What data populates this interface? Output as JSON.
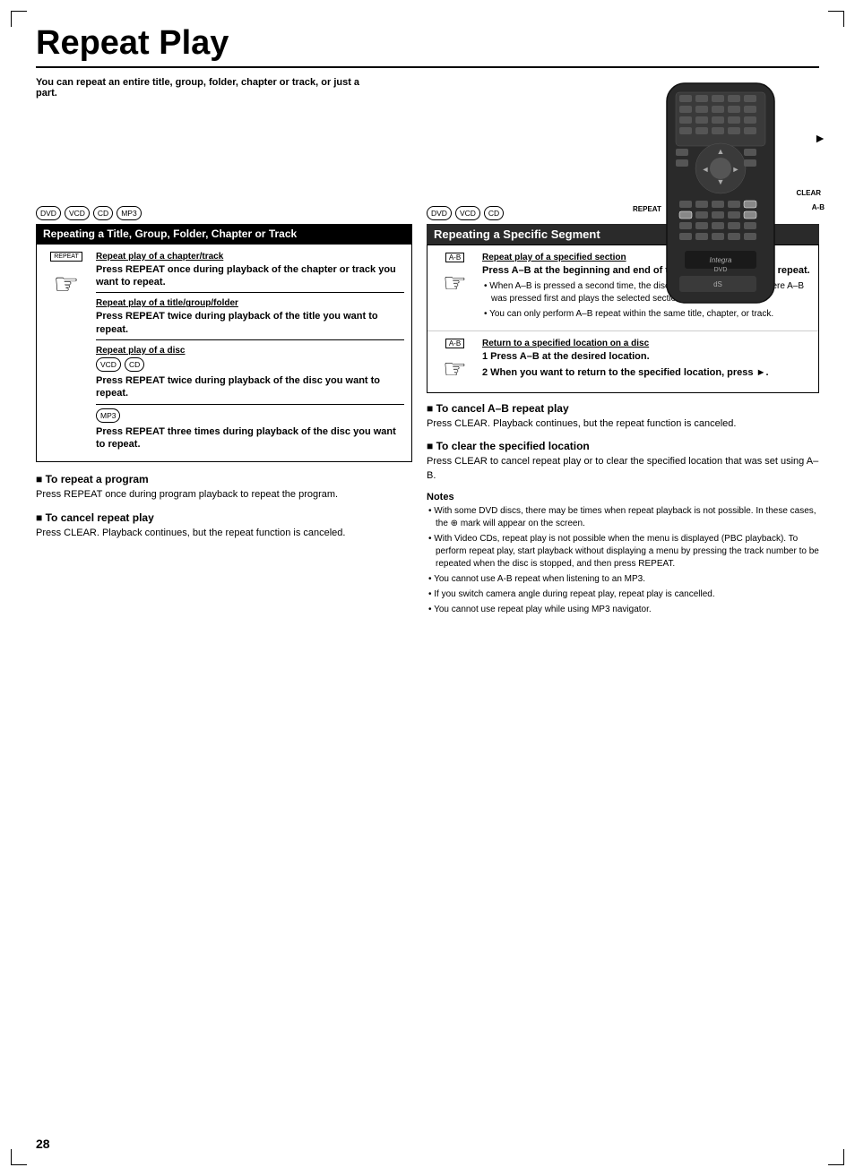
{
  "page": {
    "number": "28",
    "corner_marks": true
  },
  "title": "Repeat Play",
  "title_rule": true,
  "intro": "You can repeat an entire title, group, folder, chapter or track, or just a part.",
  "left_column": {
    "format_badges": [
      "DVD",
      "VCD",
      "CD",
      "MP3"
    ],
    "section_header": "Repeating a Title, Group, Folder, Chapter or Track",
    "repeat_label": "REPEAT",
    "hand_char": "☞",
    "instructions": [
      {
        "heading": "Repeat play of a chapter/track",
        "text": "Press REPEAT once during playback of the chapter or track you want to repeat."
      },
      {
        "heading": "Repeat play of a title/group/folder",
        "text": "Press REPEAT twice during playback of the title you want to repeat."
      },
      {
        "heading": "Repeat play of a disc",
        "badges": [
          "VCD",
          "CD"
        ],
        "text": "Press REPEAT twice during playback of the disc you want to repeat."
      },
      {
        "badges": [
          "MP3"
        ],
        "text": "Press REPEAT three times during playback of the disc you want to repeat."
      }
    ],
    "sub_sections": [
      {
        "title": "To repeat a program",
        "text": "Press REPEAT once during program playback to repeat the program."
      },
      {
        "title": "To cancel repeat play",
        "text": "Press CLEAR. Playback continues, but the repeat function is canceled."
      }
    ]
  },
  "right_column": {
    "format_badges": [
      "DVD",
      "VCD",
      "CD"
    ],
    "section_header": "Repeating a Specific Segment",
    "ab_label_1": "A-B",
    "ab_label_2": "A-B",
    "segment_1": {
      "heading": "Repeat play of a specified section",
      "main_text": "Press A–B at the beginning and end of the section you want to repeat.",
      "bullets": [
        "When A–B is pressed a second time, the disc returns to the location where A–B was pressed first and plays the selected section repeatedly.",
        "You can only perform A–B repeat within the same title, chapter, or track."
      ]
    },
    "segment_2": {
      "heading": "Return to a specified location on a disc",
      "items": [
        "Press A–B at the desired location.",
        "When you want to return to the specified location, press ►."
      ]
    },
    "sub_sections": [
      {
        "title": "To cancel A–B repeat play",
        "text": "Press CLEAR. Playback continues, but the repeat function is canceled."
      },
      {
        "title": "To clear the specified location",
        "text": "Press CLEAR to cancel repeat play or to clear the specified location that was set using A–B."
      }
    ],
    "notes_title": "Notes",
    "notes": [
      "With some DVD discs, there may be times when repeat playback is not possible. In these cases, the ⊕ mark will appear on the screen.",
      "With Video CDs, repeat play is not possible when the menu is displayed (PBC playback). To perform repeat play, start playback without displaying a menu by pressing the track number to be repeated when the disc is stopped, and then press REPEAT.",
      "You cannot use A-B repeat when listening to an MP3.",
      "If you switch camera angle during repeat play, repeat play is cancelled.",
      "You cannot use repeat play while using MP3 navigator."
    ]
  },
  "remote": {
    "label_repeat": "REPEAT",
    "label_clear": "CLEAR",
    "label_ab": "A-B",
    "arrow_char": "►"
  }
}
